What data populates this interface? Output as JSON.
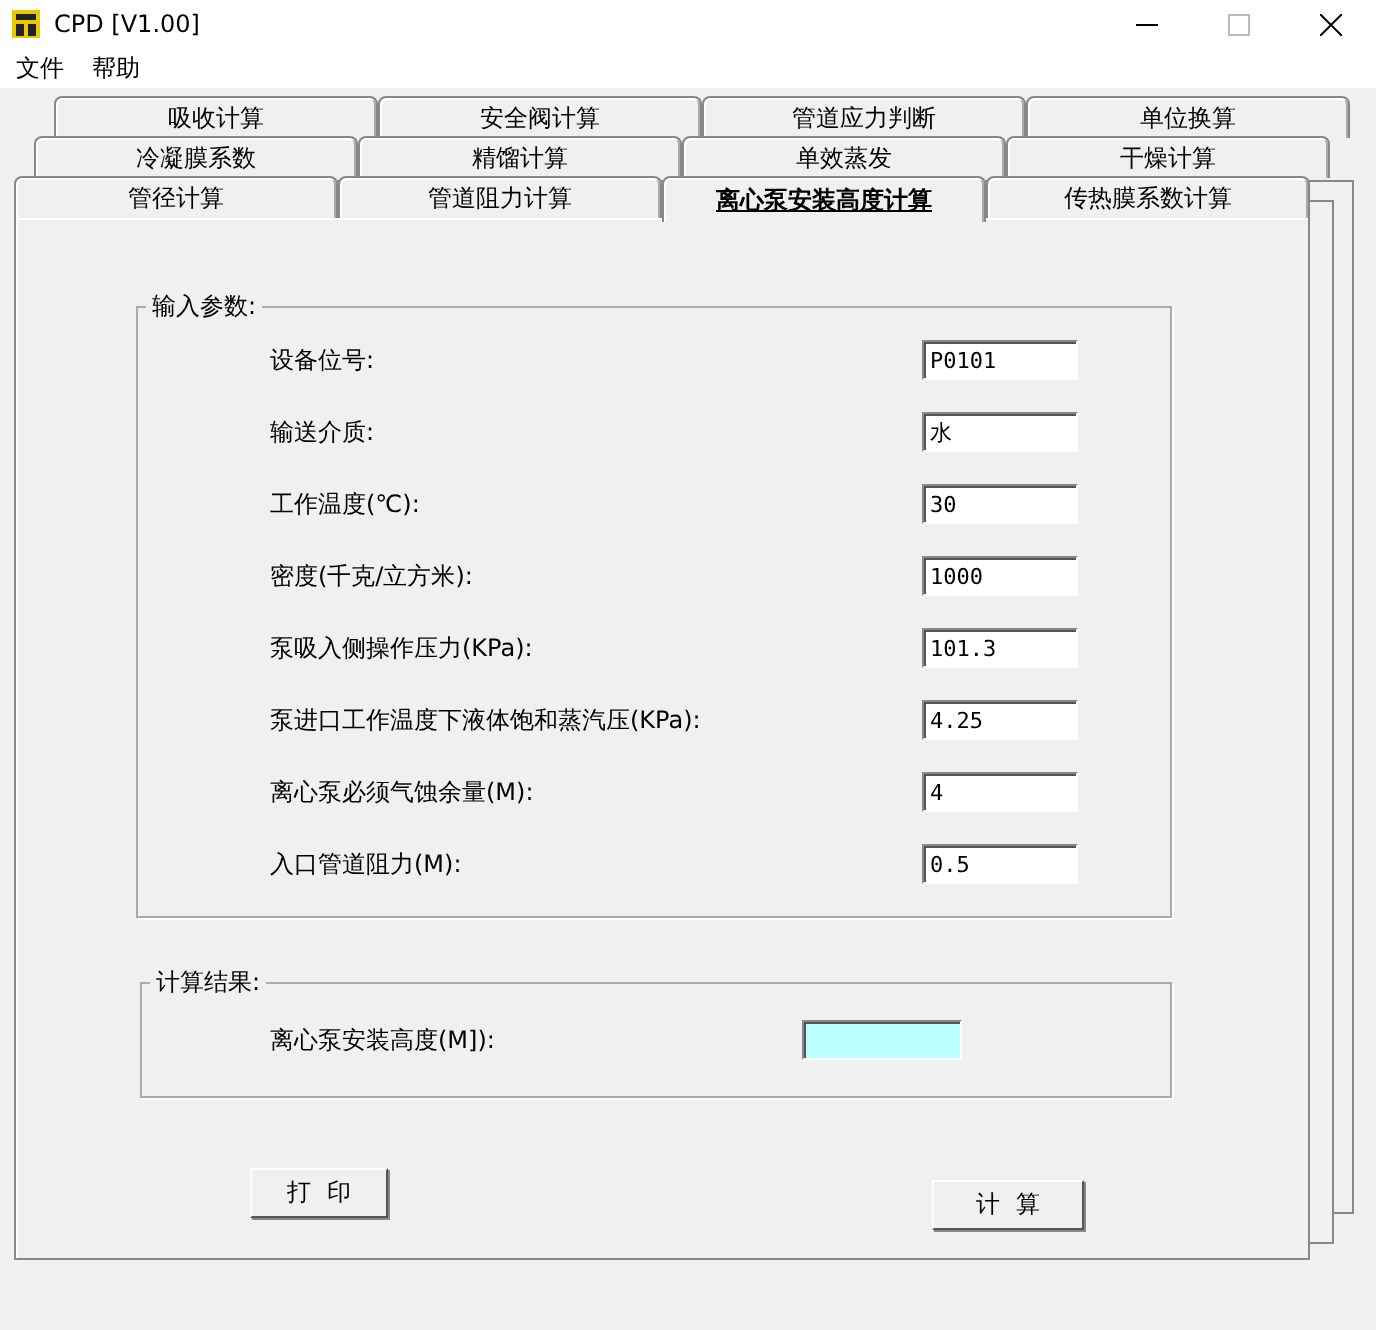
{
  "window": {
    "title": "CPD [V1.00]"
  },
  "menu": [
    "文件",
    "帮助"
  ],
  "tab_rows": [
    [
      {
        "label": "吸收计算",
        "selected": false
      },
      {
        "label": "安全阀计算",
        "selected": false
      },
      {
        "label": "管道应力判断",
        "selected": false
      },
      {
        "label": "单位换算",
        "selected": false
      }
    ],
    [
      {
        "label": "冷凝膜系数",
        "selected": false
      },
      {
        "label": "精馏计算",
        "selected": false
      },
      {
        "label": "单效蒸发",
        "selected": false
      },
      {
        "label": "干燥计算",
        "selected": false
      }
    ],
    [
      {
        "label": "管径计算",
        "selected": false
      },
      {
        "label": "管道阻力计算",
        "selected": false
      },
      {
        "label": "离心泵安装高度计算",
        "selected": true
      },
      {
        "label": "传热膜系数计算",
        "selected": false
      }
    ]
  ],
  "input_group": {
    "title": "输入参数:",
    "fields": [
      {
        "label": "设备位号:",
        "value": "P0101"
      },
      {
        "label": "输送介质:",
        "value": "水"
      },
      {
        "label": "工作温度(℃):",
        "value": "30"
      },
      {
        "label": "密度(千克/立方米):",
        "value": "1000"
      },
      {
        "label": "泵吸入侧操作压力(KPa):",
        "value": "101.3"
      },
      {
        "label": "泵进口工作温度下液体饱和蒸汽压(KPa):",
        "value": "4.25"
      },
      {
        "label": "离心泵必须气蚀余量(M):",
        "value": "4"
      },
      {
        "label": "入口管道阻力(M):",
        "value": "0.5"
      }
    ]
  },
  "result_group": {
    "title": "计算结果:",
    "fields": [
      {
        "label": "离心泵安装高度(M]):"
      }
    ]
  },
  "buttons": [
    "打  印",
    "计  算"
  ]
}
